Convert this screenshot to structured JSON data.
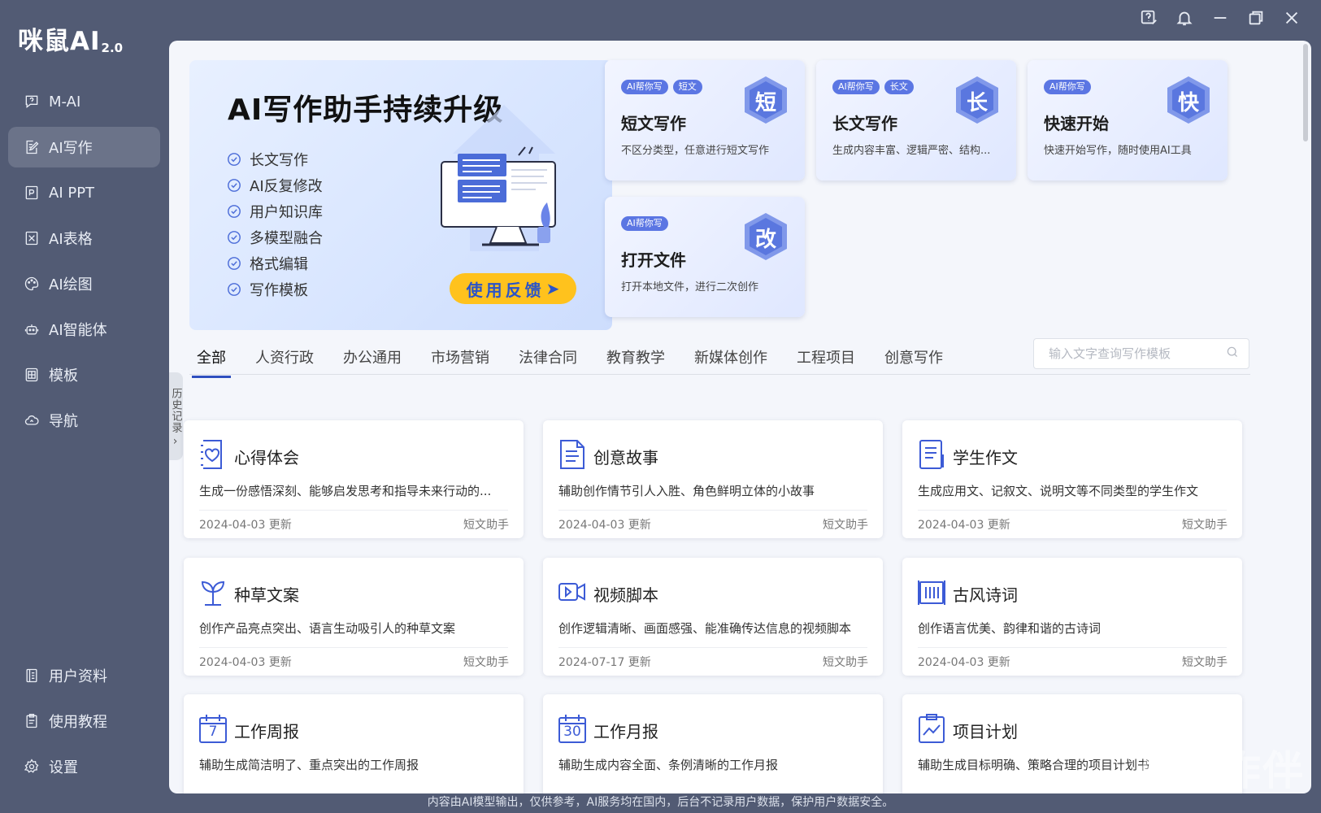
{
  "app": {
    "logo_main": "咪鼠AI",
    "logo_version": "2.0"
  },
  "sidebar": {
    "items": [
      {
        "label": "M-AI",
        "icon": "help-chat-icon"
      },
      {
        "label": "AI写作",
        "icon": "edit-doc-icon",
        "active": true
      },
      {
        "label": "AI PPT",
        "icon": "ppt-icon"
      },
      {
        "label": "AI表格",
        "icon": "table-icon"
      },
      {
        "label": "AI绘图",
        "icon": "palette-icon"
      },
      {
        "label": "AI智能体",
        "icon": "robot-icon"
      },
      {
        "label": "模板",
        "icon": "template-icon"
      },
      {
        "label": "导航",
        "icon": "cloud-nav-icon"
      }
    ],
    "bottom_items": [
      {
        "label": "用户资料",
        "icon": "user-doc-icon"
      },
      {
        "label": "使用教程",
        "icon": "tutorial-icon"
      },
      {
        "label": "设置",
        "icon": "gear-icon"
      }
    ]
  },
  "history_tab": "历史记录",
  "hero": {
    "title": "AI写作助手持续升级",
    "features": [
      "长文写作",
      "AI反复修改",
      "用户知识库",
      "多模型融合",
      "格式编辑",
      "写作模板"
    ],
    "button": "使用反馈"
  },
  "feature_cards": [
    {
      "tags": [
        "AI帮你写",
        "短文"
      ],
      "title": "短文写作",
      "desc": "不区分类型，任意进行短文写作",
      "badge": "短"
    },
    {
      "tags": [
        "AI帮你写",
        "长文"
      ],
      "title": "长文写作",
      "desc": "生成内容丰富、逻辑严密、结构...",
      "badge": "长"
    },
    {
      "tags": [
        "AI帮你写"
      ],
      "title": "快速开始",
      "desc": "快速开始写作，随时使用AI工具",
      "badge": "快"
    },
    {
      "tags": [
        "AI帮你写"
      ],
      "title": "打开文件",
      "desc": "打开本地文件，进行二次创作",
      "badge": "改"
    }
  ],
  "tabs": [
    "全部",
    "人资行政",
    "办公通用",
    "市场营销",
    "法律合同",
    "教育教学",
    "新媒体创作",
    "工程项目",
    "创意写作"
  ],
  "search": {
    "placeholder": "输入文字查询写作模板"
  },
  "templates": [
    {
      "title": "心得体会",
      "desc": "生成一份感悟深刻、能够启发思考和指导未来行动的...",
      "date": "2024-04-03 更新",
      "type": "短文助手"
    },
    {
      "title": "创意故事",
      "desc": "辅助创作情节引人入胜、角色鲜明立体的小故事",
      "date": "2024-04-03 更新",
      "type": "短文助手"
    },
    {
      "title": "学生作文",
      "desc": "生成应用文、记叙文、说明文等不同类型的学生作文",
      "date": "2024-04-03 更新",
      "type": "短文助手"
    },
    {
      "title": "种草文案",
      "desc": "创作产品亮点突出、语言生动吸引人的种草文案",
      "date": "2024-04-03 更新",
      "type": "短文助手"
    },
    {
      "title": "视频脚本",
      "desc": "创作逻辑清晰、画面感强、能准确传达信息的视频脚本",
      "date": "2024-07-17 更新",
      "type": "短文助手"
    },
    {
      "title": "古风诗词",
      "desc": "创作语言优美、韵律和谐的古诗词",
      "date": "2024-04-03 更新",
      "type": "短文助手"
    },
    {
      "title": "工作周报",
      "desc": "辅助生成简洁明了、重点突出的工作周报",
      "date": "",
      "type": ""
    },
    {
      "title": "工作月报",
      "desc": "辅助生成内容全面、条例清晰的工作月报",
      "date": "",
      "type": ""
    },
    {
      "title": "项目计划",
      "desc": "辅助生成目标明确、策略合理的项目计划书",
      "date": "",
      "type": ""
    }
  ],
  "icon_labels": {
    "weekly": "7",
    "monthly": "30"
  },
  "footer": "内容由AI模型输出，仅供参考，AI服务均在国内，后台不记录用户数据，保护用户数据安全。",
  "watermark": "与秋作伴",
  "colors": {
    "accent": "#2f4fbf",
    "sidebar_bg": "#525b74",
    "button_yellow": "#ffc21d",
    "tag_blue": "#5b76e3"
  }
}
